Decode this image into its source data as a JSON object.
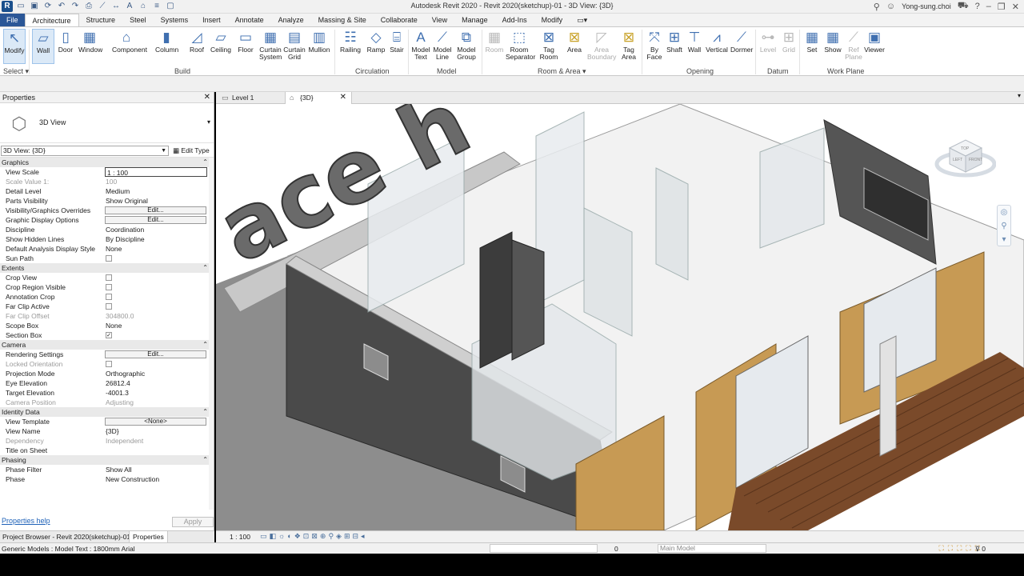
{
  "window": {
    "title": "Autodesk Revit 2020 - Revit 2020(sketchup)-01 - 3D View: {3D}",
    "user": "Yong-sung.choi"
  },
  "ribbon_tabs": [
    "File",
    "Architecture",
    "Structure",
    "Steel",
    "Systems",
    "Insert",
    "Annotate",
    "Analyze",
    "Massing & Site",
    "Collaborate",
    "View",
    "Manage",
    "Add-Ins",
    "Modify"
  ],
  "ribbon": {
    "modify": "Modify",
    "select": "Select",
    "build": {
      "label": "Build",
      "wall": "Wall",
      "door": "Door",
      "window": "Window",
      "component": "Component",
      "column": "Column",
      "roof": "Roof",
      "ceiling": "Ceiling",
      "floor": "Floor",
      "curtain_system_1": "Curtain",
      "curtain_system_2": "System",
      "curtain_grid_1": "Curtain",
      "curtain_grid_2": "Grid",
      "mullion": "Mullion"
    },
    "circulation": {
      "label": "Circulation",
      "railing": "Railing",
      "ramp": "Ramp",
      "stair": "Stair"
    },
    "model": {
      "label": "Model",
      "text_1": "Model",
      "text_2": "Text",
      "line_1": "Model",
      "line_2": "Line",
      "group_1": "Model",
      "group_2": "Group"
    },
    "room_area": {
      "label": "Room & Area",
      "room": "Room",
      "sep_1": "Room",
      "sep_2": "Separator",
      "tagroom_1": "Tag",
      "tagroom_2": "Room",
      "area": "Area",
      "areab_1": "Area",
      "areab_2": "Boundary",
      "tagarea_1": "Tag",
      "tagarea_2": "Area"
    },
    "opening": {
      "label": "Opening",
      "byface_1": "By",
      "byface_2": "Face",
      "shaft": "Shaft",
      "wall": "Wall",
      "vertical": "Vertical",
      "dormer": "Dormer"
    },
    "datum": {
      "label": "Datum",
      "level": "Level",
      "grid": "Grid"
    },
    "workplane": {
      "label": "Work Plane",
      "set": "Set",
      "show": "Show",
      "refplane_1": "Ref",
      "refplane_2": "Plane",
      "viewer": "Viewer"
    }
  },
  "properties": {
    "title": "Properties",
    "type_name": "3D View",
    "instance_selector": "3D View: {3D}",
    "edit_type": "Edit Type",
    "groups": {
      "graphics": "Graphics",
      "extents": "Extents",
      "camera": "Camera",
      "identity": "Identity Data",
      "phasing": "Phasing"
    },
    "rows": {
      "view_scale": {
        "k": "View Scale",
        "v": "1 : 100"
      },
      "scale_value": {
        "k": "Scale Value    1:",
        "v": "100"
      },
      "detail_level": {
        "k": "Detail Level",
        "v": "Medium"
      },
      "parts_visibility": {
        "k": "Parts Visibility",
        "v": "Show Original"
      },
      "vg_overrides": {
        "k": "Visibility/Graphics Overrides",
        "v": "Edit..."
      },
      "gd_options": {
        "k": "Graphic Display Options",
        "v": "Edit..."
      },
      "discipline": {
        "k": "Discipline",
        "v": "Coordination"
      },
      "hidden_lines": {
        "k": "Show Hidden Lines",
        "v": "By Discipline"
      },
      "analysis_style": {
        "k": "Default Analysis Display Style",
        "v": "None"
      },
      "sun_path": {
        "k": "Sun Path",
        "v": ""
      },
      "crop_view": {
        "k": "Crop View",
        "v": ""
      },
      "crop_region": {
        "k": "Crop Region Visible",
        "v": ""
      },
      "annotation_crop": {
        "k": "Annotation Crop",
        "v": ""
      },
      "far_clip_active": {
        "k": "Far Clip Active",
        "v": ""
      },
      "far_clip_offset": {
        "k": "Far Clip Offset",
        "v": "304800.0"
      },
      "scope_box": {
        "k": "Scope Box",
        "v": "None"
      },
      "section_box": {
        "k": "Section Box",
        "v": "✓"
      },
      "rendering": {
        "k": "Rendering Settings",
        "v": "Edit..."
      },
      "locked_orientation": {
        "k": "Locked Orientation",
        "v": ""
      },
      "projection_mode": {
        "k": "Projection Mode",
        "v": "Orthographic"
      },
      "eye_elevation": {
        "k": "Eye Elevation",
        "v": "26812.4"
      },
      "target_elevation": {
        "k": "Target Elevation",
        "v": "-4001.3"
      },
      "camera_position": {
        "k": "Camera Position",
        "v": "Adjusting"
      },
      "view_template": {
        "k": "View Template",
        "v": "<None>"
      },
      "view_name": {
        "k": "View Name",
        "v": "{3D}"
      },
      "dependency": {
        "k": "Dependency",
        "v": "Independent"
      },
      "title_on_sheet": {
        "k": "Title on Sheet",
        "v": ""
      },
      "phase_filter": {
        "k": "Phase Filter",
        "v": "Show All"
      },
      "phase": {
        "k": "Phase",
        "v": "New Construction"
      }
    },
    "help": "Properties help",
    "apply": "Apply"
  },
  "browser_tabs": {
    "project_browser": "Project Browser - Revit 2020(sketchup)-01",
    "properties": "Properties"
  },
  "view_tabs": {
    "level1": "Level 1",
    "view3d": "{3D}"
  },
  "view_control": {
    "scale": "1 : 100"
  },
  "status": {
    "message": "Generic Models : Model Text : 1800mm Arial",
    "worksharing": "0",
    "model": "Main Model",
    "filter_count": "0"
  },
  "viewcube": {
    "top": "TOP",
    "front": "FRONT",
    "left": "LEFT"
  },
  "model_text": "ace h"
}
